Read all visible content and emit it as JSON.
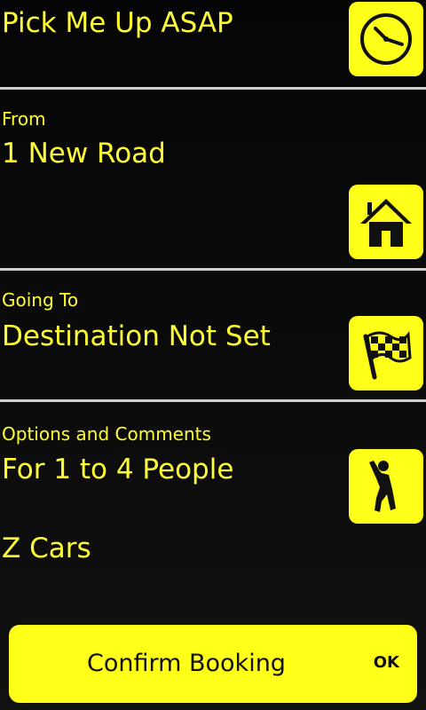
{
  "pickup": {
    "title": "Pick Me Up ASAP",
    "icon": "clock-icon"
  },
  "from": {
    "label": "From",
    "value": "1 New Road",
    "icon": "home-icon"
  },
  "going_to": {
    "label": "Going To",
    "value": "Destination Not Set",
    "icon": "checkered-flag-icon"
  },
  "options": {
    "label": "Options and Comments",
    "people": "For 1 to 4 People",
    "company": "Z Cars",
    "icon": "person-icon"
  },
  "confirm": {
    "label": "Confirm Booking",
    "ok": "OK"
  },
  "colors": {
    "accent": "#ffff1a",
    "background": "#0a0a0a",
    "divider": "#cfcfcf"
  }
}
